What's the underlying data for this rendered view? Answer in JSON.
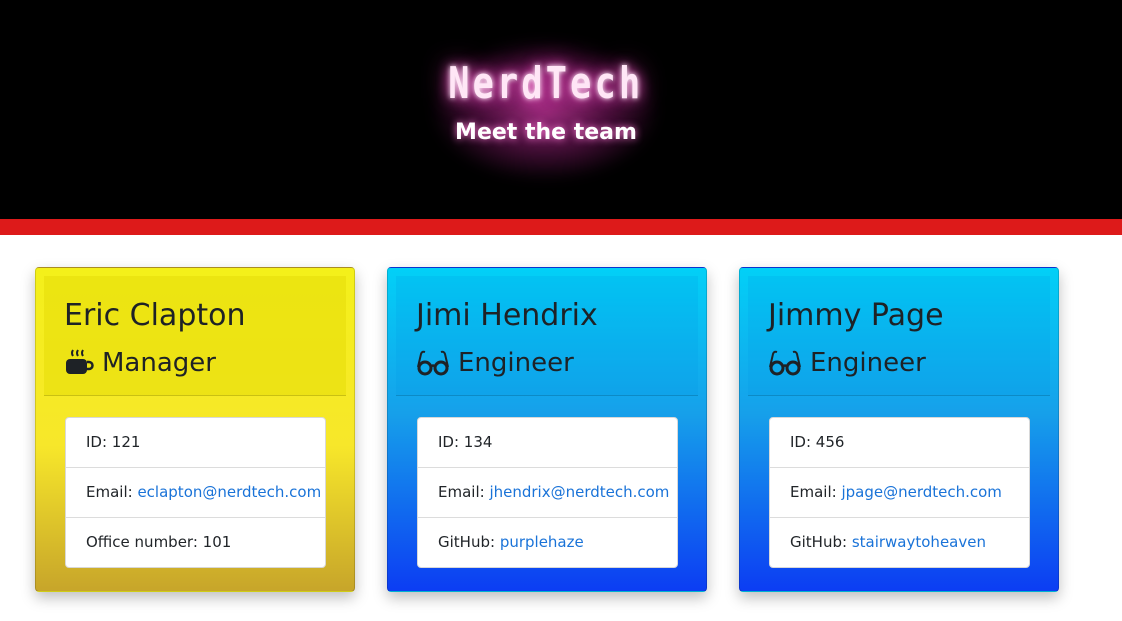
{
  "header": {
    "brand": "NerdTech",
    "subtitle": "Meet the team"
  },
  "colors": {
    "header_bg": "#000000",
    "glow": "#e03bb0",
    "accent_bar": "#dd1a1a",
    "manager_card": "#f4f01a",
    "engineer_card": "#02d0f7",
    "link": "#1a73d8"
  },
  "team": [
    {
      "name": "Eric Clapton",
      "role": "Manager",
      "role_icon": "coffee-mug-icon",
      "id_label": "ID: 121",
      "email_prefix": "Email: ",
      "email": "eclapton@nerdtech.com",
      "extra_prefix": "Office number: 101",
      "extra_link": ""
    },
    {
      "name": "Jimi Hendrix",
      "role": "Engineer",
      "role_icon": "glasses-icon",
      "id_label": "ID: 134",
      "email_prefix": "Email: ",
      "email": "jhendrix@nerdtech.com",
      "extra_prefix": "GitHub: ",
      "extra_link": "purplehaze"
    },
    {
      "name": "Jimmy Page",
      "role": "Engineer",
      "role_icon": "glasses-icon",
      "id_label": "ID: 456",
      "email_prefix": "Email: ",
      "email": "jpage@nerdtech.com",
      "extra_prefix": "GitHub: ",
      "extra_link": "stairwaytoheaven"
    }
  ]
}
